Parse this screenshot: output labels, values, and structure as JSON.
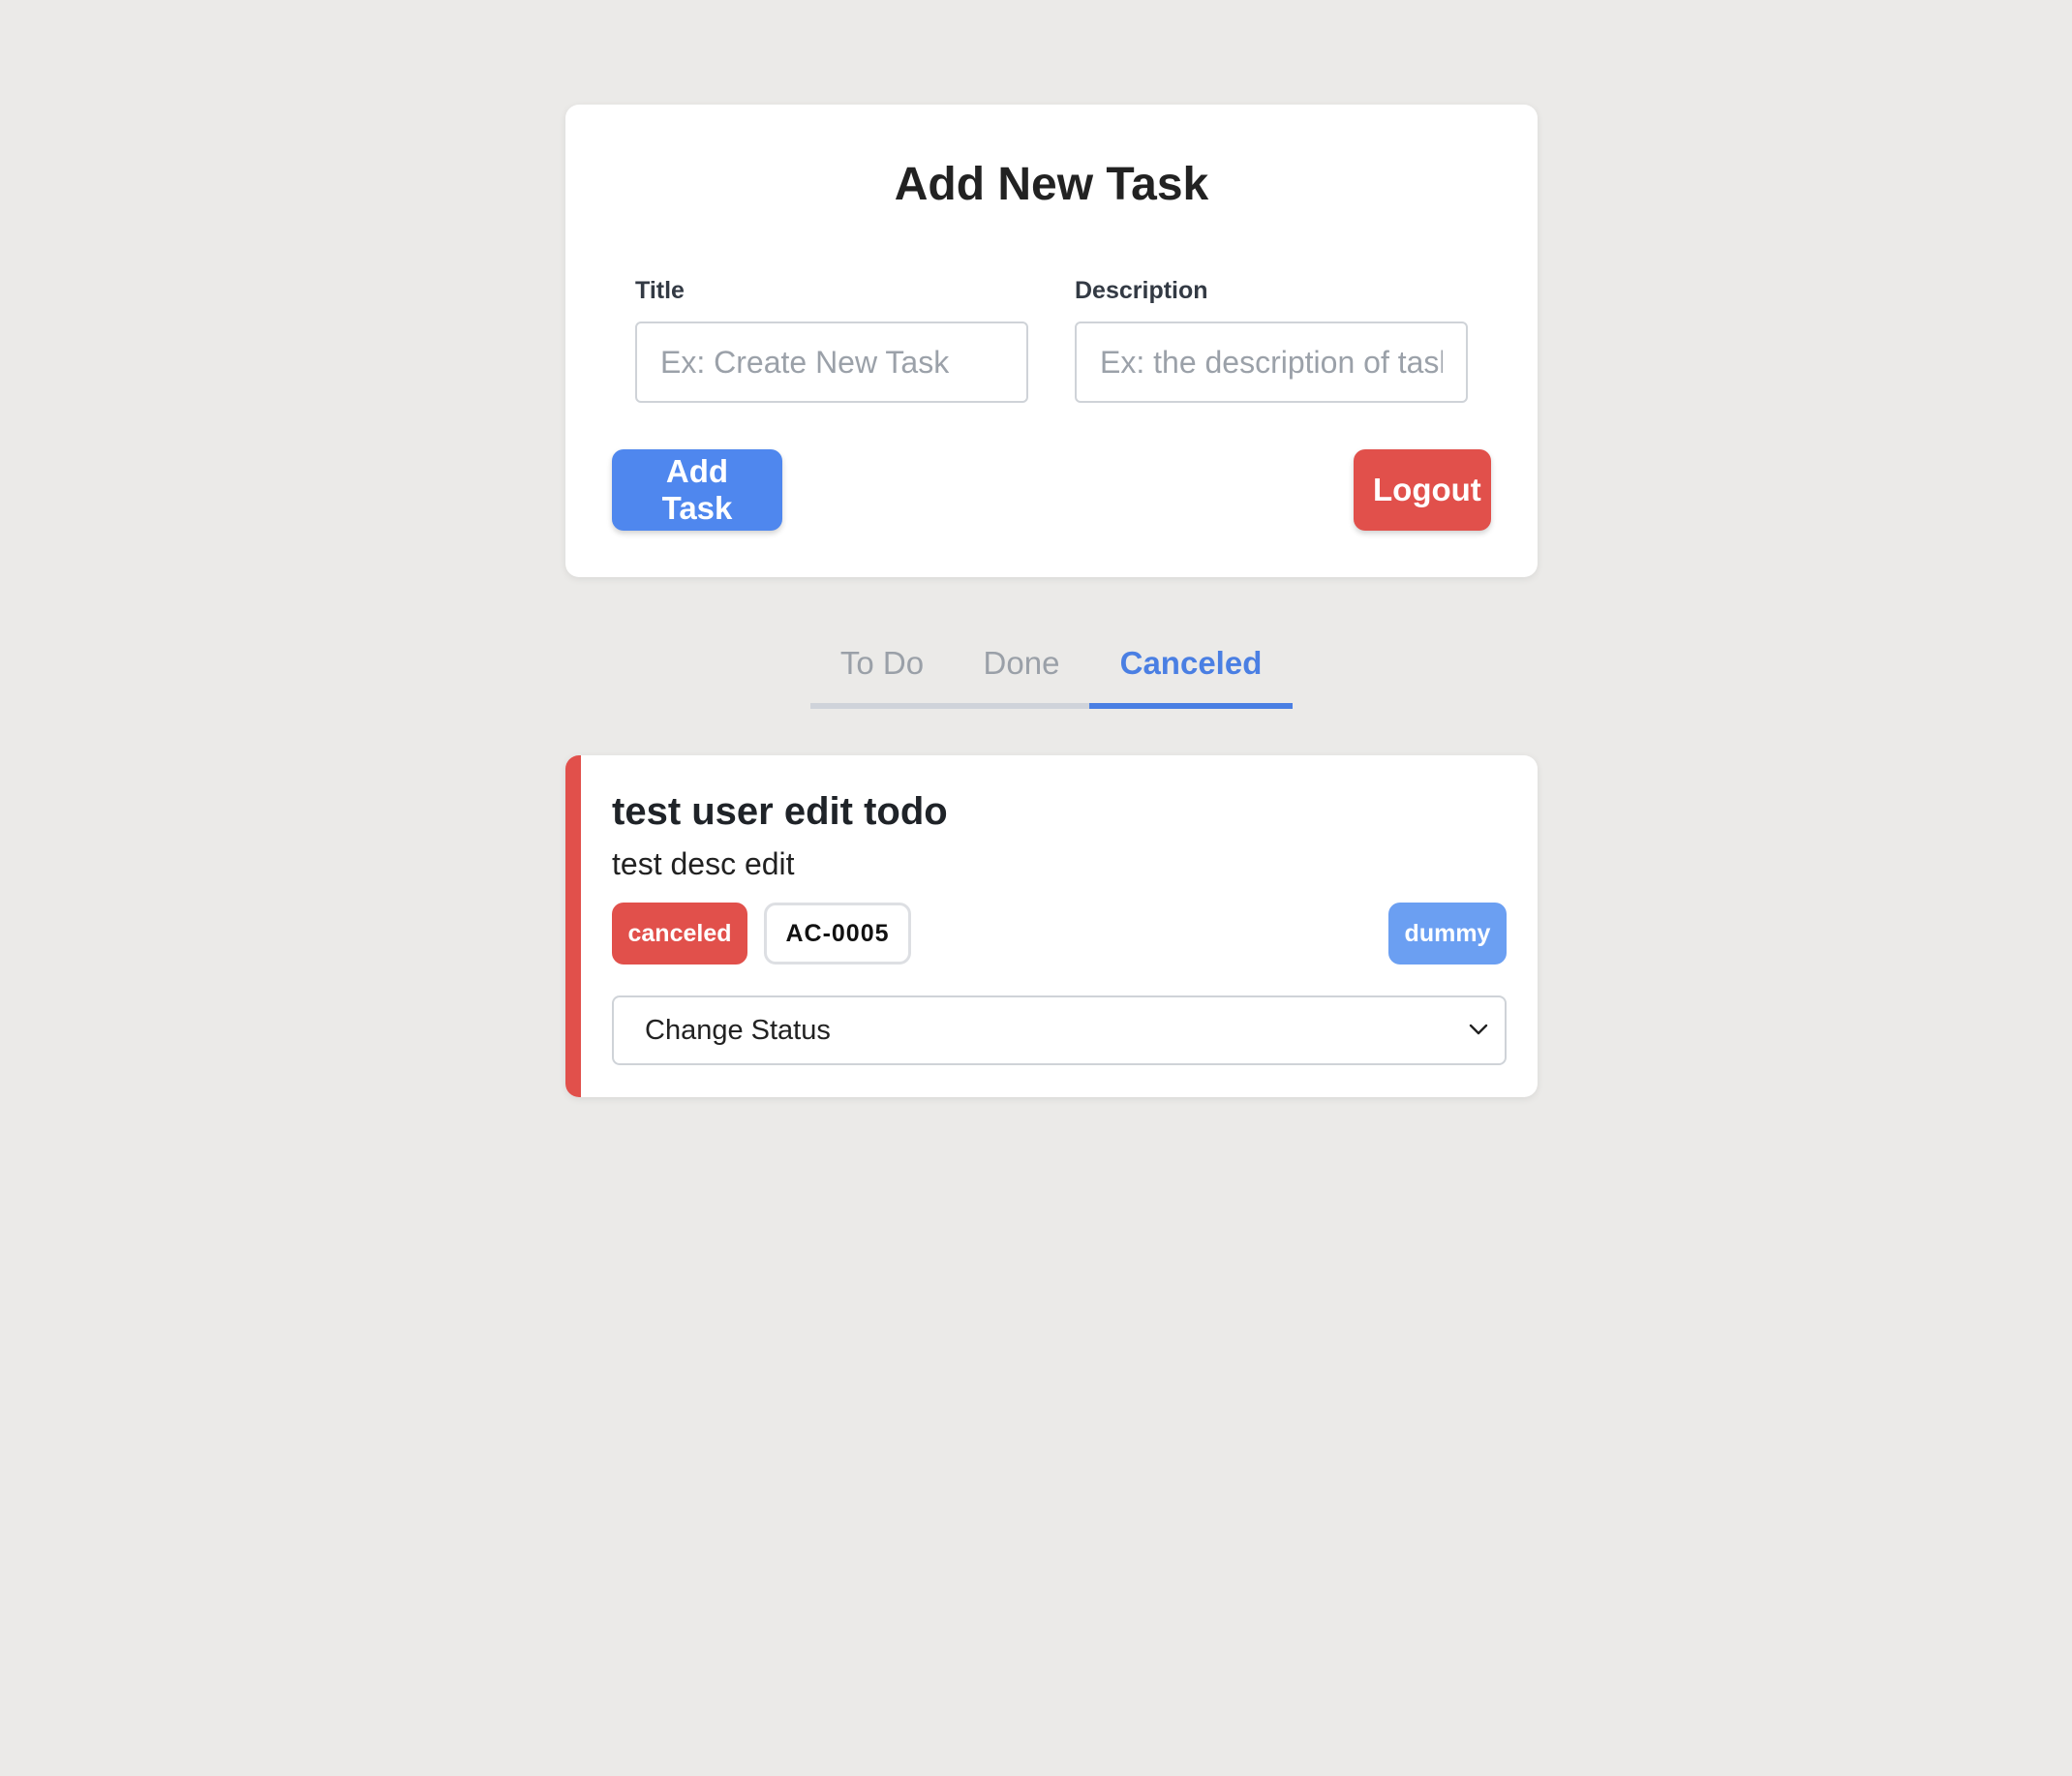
{
  "form": {
    "title": "Add New Task",
    "title_label": "Title",
    "title_placeholder": "Ex: Create New Task",
    "title_value": "",
    "description_label": "Description",
    "description_placeholder": "Ex: the description of task",
    "description_value": "",
    "add_button": "Add Task",
    "logout_button": "Logout"
  },
  "tabs": [
    {
      "label": "To Do",
      "active": false
    },
    {
      "label": "Done",
      "active": false
    },
    {
      "label": "Canceled",
      "active": true
    }
  ],
  "tasks": [
    {
      "title": "test user edit todo",
      "description": "test desc edit",
      "status": "canceled",
      "code": "AC-0005",
      "tag": "dummy",
      "change_status_label": "Change Status"
    }
  ],
  "colors": {
    "primary": "#4f87ee",
    "danger": "#e1504b",
    "tag": "#6b9ff2",
    "background": "#ebeae8"
  },
  "icons": {
    "select_chevron": "chevron-down-icon"
  }
}
